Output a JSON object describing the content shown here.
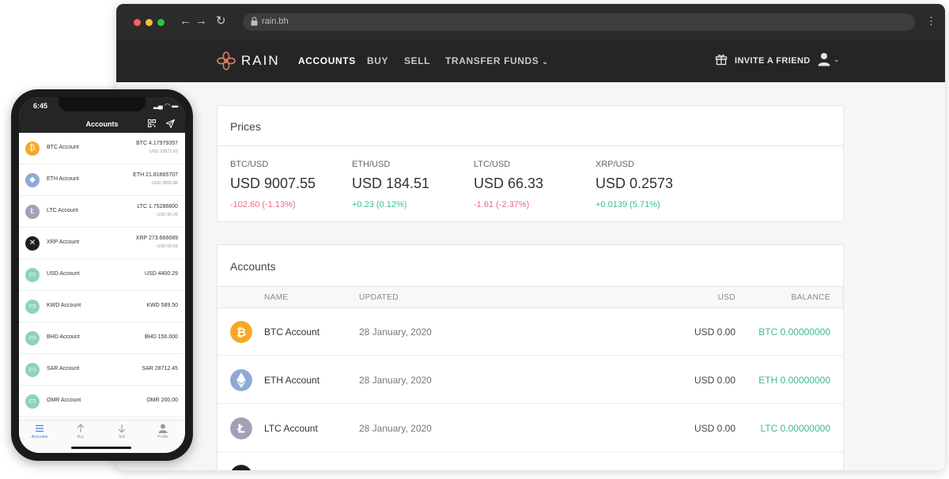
{
  "browser": {
    "url": "rain.bh",
    "brand": "RAIN",
    "nav": [
      "ACCOUNTS",
      "BUY",
      "SELL",
      "TRANSFER FUNDS"
    ],
    "active_nav": "ACCOUNTS",
    "invite_label": "INVITE A FRIEND"
  },
  "prices": {
    "title": "Prices",
    "items": [
      {
        "pair": "BTC/USD",
        "value": "USD 9007.55",
        "change": "-102.60 (-1.13%)",
        "direction": "down"
      },
      {
        "pair": "ETH/USD",
        "value": "USD 184.51",
        "change": "+0.23 (0.12%)",
        "direction": "up"
      },
      {
        "pair": "LTC/USD",
        "value": "USD 66.33",
        "change": "-1.61 (-2.37%)",
        "direction": "down"
      },
      {
        "pair": "XRP/USD",
        "value": "USD 0.2573",
        "change": "+0.0139 (5.71%)",
        "direction": "up"
      }
    ]
  },
  "accounts": {
    "title": "Accounts",
    "columns": {
      "name": "NAME",
      "updated": "UPDATED",
      "usd": "USD",
      "balance": "BALANCE"
    },
    "rows": [
      {
        "name": "BTC Account",
        "updated": "28 January, 2020",
        "usd": "USD 0.00",
        "balance": "BTC 0.00000000",
        "icon": "bitcoin-icon",
        "color": "#f7a823"
      },
      {
        "name": "ETH Account",
        "updated": "28 January, 2020",
        "usd": "USD 0.00",
        "balance": "ETH 0.00000000",
        "icon": "ethereum-icon",
        "color": "#8fa9d6"
      },
      {
        "name": "LTC Account",
        "updated": "28 January, 2020",
        "usd": "USD 0.00",
        "balance": "LTC 0.00000000",
        "icon": "litecoin-icon",
        "color": "#a3a1b8"
      }
    ]
  },
  "phone": {
    "time": "6:45",
    "title": "Accounts",
    "rows": [
      {
        "name": "BTC Account",
        "balance": "BTC 4.17979357",
        "usd": "USD 33872.63",
        "icon": "bitcoin-icon",
        "color": "#f7a823",
        "glyph": "₿"
      },
      {
        "name": "ETH Account",
        "balance": "ETH 21.81665707",
        "usd": "USD 3855.88",
        "icon": "ethereum-icon",
        "color": "#8fa9d6",
        "glyph": "◆"
      },
      {
        "name": "LTC Account",
        "balance": "LTC 1.75286800",
        "usd": "USD 96.25",
        "icon": "litecoin-icon",
        "color": "#a3a1b8",
        "glyph": "Ł"
      },
      {
        "name": "XRP Account",
        "balance": "XRP 273.666689",
        "usd": "USD 68.58",
        "icon": "xrp-icon",
        "color": "#1e1e1e",
        "glyph": "✕"
      },
      {
        "name": "USD Account",
        "balance": "USD 4400.29",
        "icon": "cash-icon",
        "color": "#8fd3b8",
        "glyph": "▭"
      },
      {
        "name": "KWD Account",
        "balance": "KWD 589.50",
        "icon": "cash-icon",
        "color": "#8fd3b8",
        "glyph": "▭"
      },
      {
        "name": "BHD Account",
        "balance": "BHD 150.000",
        "icon": "cash-icon",
        "color": "#8fd3b8",
        "glyph": "▭"
      },
      {
        "name": "SAR Account",
        "balance": "SAR 28712.45",
        "icon": "cash-icon",
        "color": "#8fd3b8",
        "glyph": "▭"
      },
      {
        "name": "OMR Account",
        "balance": "OMR 200.00",
        "icon": "cash-icon",
        "color": "#8fd3b8",
        "glyph": "▭"
      }
    ],
    "tabs": [
      "Accounts",
      "Buy",
      "Sell",
      "Profile"
    ],
    "active_tab": "Accounts"
  },
  "colors": {
    "positive": "#3fba8a",
    "negative": "#e36d7f",
    "nav_bg": "#252525",
    "link_active": "#4a7fd1"
  }
}
